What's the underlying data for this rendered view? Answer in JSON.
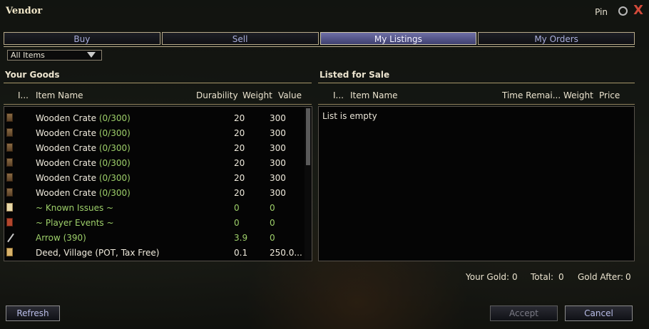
{
  "window": {
    "title": "Vendor",
    "pin_label": "Pin",
    "close_symbol": "X"
  },
  "tabs": [
    {
      "label": "Buy",
      "active": false
    },
    {
      "label": "Sell",
      "active": false
    },
    {
      "label": "My Listings",
      "active": true
    },
    {
      "label": "My Orders",
      "active": false
    }
  ],
  "filter": {
    "selected": "All Items"
  },
  "left": {
    "title": "Your Goods",
    "columns": {
      "icon": "I...",
      "name": "Item Name",
      "durability": "Durability",
      "weight": "Weight",
      "value": "Value"
    },
    "rows": [
      {
        "icon": "crate-icon",
        "name": "Wooden Crate",
        "suffix": " (0/300)",
        "weight": "20",
        "value": "300",
        "green": false
      },
      {
        "icon": "crate-icon",
        "name": "Wooden Crate",
        "suffix": " (0/300)",
        "weight": "20",
        "value": "300",
        "green": false
      },
      {
        "icon": "crate-icon",
        "name": "Wooden Crate",
        "suffix": " (0/300)",
        "weight": "20",
        "value": "300",
        "green": false
      },
      {
        "icon": "crate-icon",
        "name": "Wooden Crate",
        "suffix": " (0/300)",
        "weight": "20",
        "value": "300",
        "green": false
      },
      {
        "icon": "crate-icon",
        "name": "Wooden Crate",
        "suffix": " (0/300)",
        "weight": "20",
        "value": "300",
        "green": false
      },
      {
        "icon": "crate-icon",
        "name": "Wooden Crate",
        "suffix": " (0/300)",
        "weight": "20",
        "value": "300",
        "green": false
      },
      {
        "icon": "scroll-icon",
        "name": "~ Known Issues ~",
        "suffix": "",
        "weight": "0",
        "value": "0",
        "green": true
      },
      {
        "icon": "book-icon",
        "name": "~ Player Events ~",
        "suffix": "",
        "weight": "0",
        "value": "0",
        "green": true
      },
      {
        "icon": "arrow-icon",
        "name": "Arrow (390)",
        "suffix": "",
        "weight": "3.9",
        "value": "0",
        "green": true
      },
      {
        "icon": "deed-icon",
        "name": "Deed, Village (POT, Tax Free)",
        "suffix": "",
        "weight": "0.1",
        "value": "250.0...",
        "green": false
      }
    ]
  },
  "right": {
    "title": "Listed for Sale",
    "columns": {
      "icon": "I...",
      "name": "Item Name",
      "time": "Time Remai...",
      "weight": "Weight",
      "price": "Price"
    },
    "empty_text": "List is empty"
  },
  "footer": {
    "gold_label": "Your Gold:",
    "gold_value": "0",
    "total_label": "Total:",
    "total_value": "0",
    "after_label": "Gold After:",
    "after_value": "0"
  },
  "buttons": {
    "refresh": "Refresh",
    "accept": "Accept",
    "cancel": "Cancel"
  },
  "colors": {
    "accent_tab": "#6e6fa6",
    "green_text": "#9ed06a",
    "close": "#d24a3a"
  }
}
